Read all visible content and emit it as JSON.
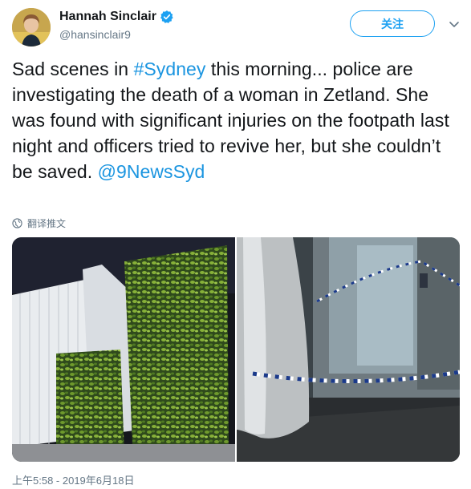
{
  "user": {
    "display_name": "Hannah Sinclair",
    "handle": "@hansinclair9",
    "verified": true,
    "avatar_icon": "profile-avatar"
  },
  "follow_button": {
    "label": "关注"
  },
  "menu_icon": "chevron-down-icon",
  "tweet": {
    "text_part1": "Sad scenes in ",
    "hashtag": "#Sydney",
    "text_part2": " this morning... police are investigating the death of a woman in Zetland. She was found with significant injuries on the footpath last night and officers tried to revive her, but she couldn’t be saved. ",
    "mention": "@9NewsSyd"
  },
  "translate": {
    "label": "翻译推文",
    "icon": "globe-icon"
  },
  "media": {
    "photos": [
      {
        "name": "hedge-fence-photo"
      },
      {
        "name": "police-tape-doorway-photo"
      }
    ]
  },
  "timestamp": "上午5:58 - 2019年6月18日",
  "colors": {
    "accent": "#1da1f2",
    "link": "#1b95e0",
    "muted": "#657786",
    "text": "#14171a"
  }
}
